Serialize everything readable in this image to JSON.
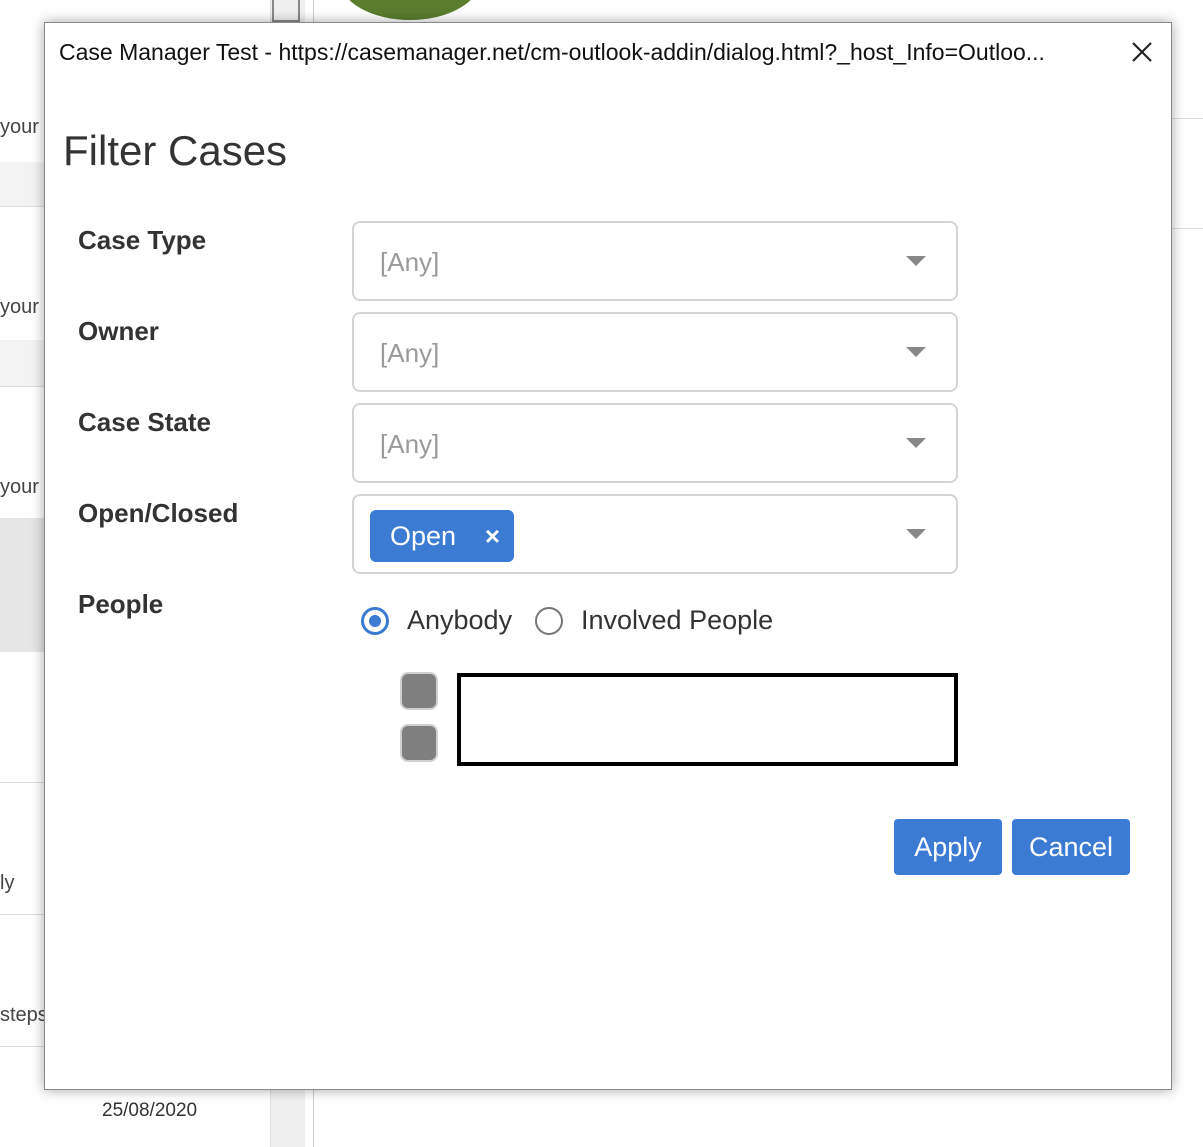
{
  "background": {
    "snippets": [
      "your",
      "your",
      "your",
      "ly",
      "steps"
    ],
    "date": "25/08/2020"
  },
  "dialog": {
    "title": "Case Manager Test - https://casemanager.net/cm-outlook-addin/dialog.html?_host_Info=Outloo...",
    "close_icon": "close-icon",
    "heading": "Filter Cases"
  },
  "filters": {
    "case_type": {
      "label": "Case Type",
      "value": "[Any]"
    },
    "owner": {
      "label": "Owner",
      "value": "[Any]"
    },
    "case_state": {
      "label": "Case State",
      "value": "[Any]"
    },
    "open_closed": {
      "label": "Open/Closed",
      "chip": "Open",
      "chip_remove": "×"
    },
    "people": {
      "label": "People",
      "options": [
        "Anybody",
        "Involved People"
      ],
      "selected": "Anybody"
    }
  },
  "buttons": {
    "apply": "Apply",
    "cancel": "Cancel"
  },
  "colors": {
    "accent": "#3b7bd4",
    "placeholder": "#9a9a9a",
    "label": "#333333"
  }
}
